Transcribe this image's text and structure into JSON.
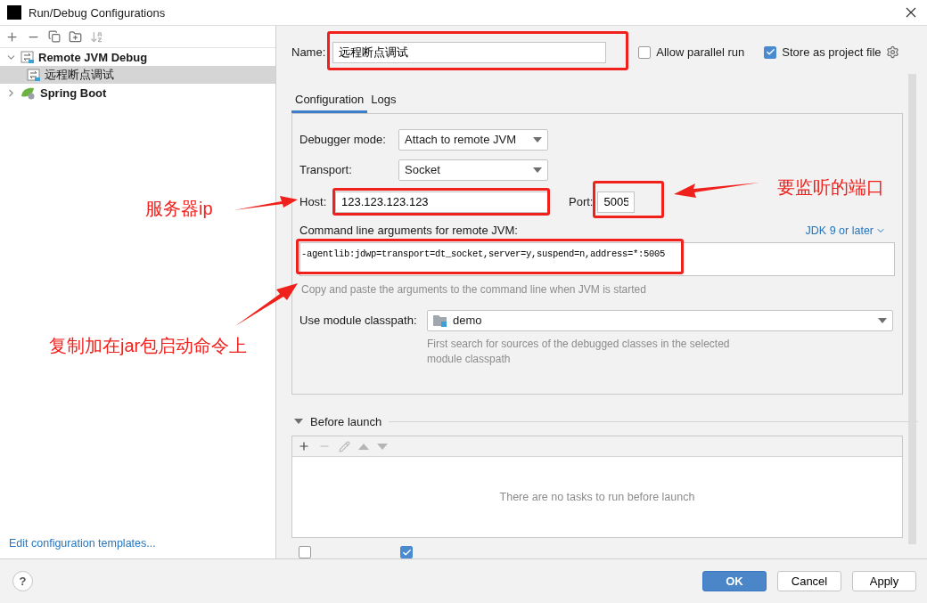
{
  "window": {
    "title": "Run/Debug Configurations"
  },
  "tree": [
    {
      "label": "Remote JVM Debug",
      "kind": "remote",
      "expanded": true,
      "selected": false,
      "children": [
        {
          "label": "远程断点调试",
          "kind": "remote",
          "selected": true
        }
      ]
    },
    {
      "label": "Spring Boot",
      "kind": "spring",
      "expanded": false,
      "selected": false
    }
  ],
  "templates_link": "Edit configuration templates...",
  "name_field": {
    "label": "Name:",
    "value": "远程断点调试"
  },
  "options": [
    {
      "label": "Allow parallel run",
      "checked": false
    },
    {
      "label": "Store as project file",
      "checked": true
    }
  ],
  "tabs": [
    {
      "label": "Configuration",
      "selected": true
    },
    {
      "label": "Logs",
      "selected": false
    }
  ],
  "debugger_mode": {
    "label": "Debugger mode:",
    "value": "Attach to remote JVM"
  },
  "transport": {
    "label": "Transport:",
    "value": "Socket"
  },
  "host": {
    "label": "Host:",
    "value": "123.123.123.123"
  },
  "port": {
    "label": "Port:",
    "value": "5005"
  },
  "command": {
    "label": "Command line arguments for remote JVM:",
    "jdk_link": "JDK 9 or later",
    "value": "-agentlib:jdwp=transport=dt_socket,server=y,suspend=n,address=*:5005",
    "hint": "Copy and paste the arguments to the command line when JVM is started"
  },
  "module": {
    "label": "Use module classpath:",
    "value": "demo",
    "hint": "First search for sources of the debugged classes in the selected module classpath"
  },
  "before_launch": {
    "title": "Before launch",
    "expanded": true,
    "empty_text": "There are no tasks to run before launch"
  },
  "bottom_options": [
    {
      "checked": false
    },
    {
      "checked": true
    }
  ],
  "help_button": "?",
  "buttons": [
    {
      "label": "OK",
      "kind": "primary"
    },
    {
      "label": "Cancel",
      "kind": "normal"
    },
    {
      "label": "Apply",
      "kind": "normal"
    }
  ],
  "annotations": [
    "服务器ip",
    "要监听的端口",
    "复制加在jar包启动命令上"
  ]
}
